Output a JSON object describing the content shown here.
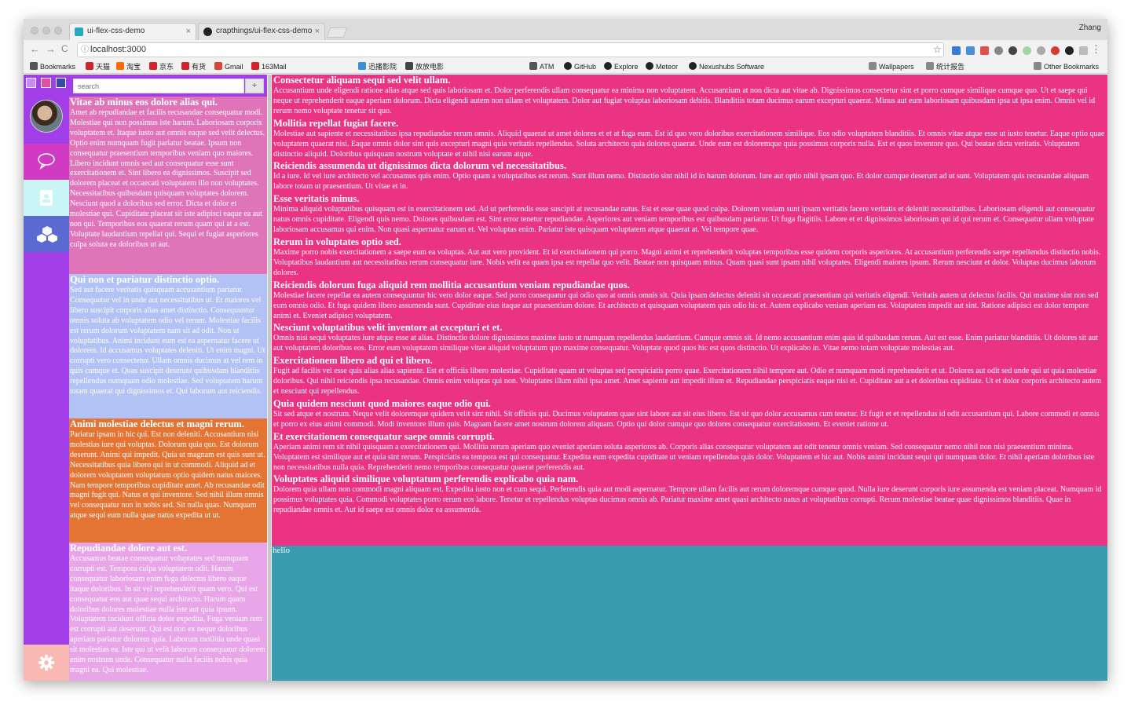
{
  "browser": {
    "tabs": [
      {
        "label": "ui-flex-css-demo",
        "close": "×"
      },
      {
        "label": "crapthings/ui-flex-css-demo",
        "close": "×"
      }
    ],
    "profile": "Zhang",
    "url": "localhost:3000",
    "nav": {
      "back": "←",
      "forward": "→",
      "reload": "C"
    },
    "bookmarks": [
      {
        "label": "Bookmarks",
        "icon": "apps-icon",
        "color": "#555555"
      },
      {
        "label": "天猫",
        "icon": "tmall-icon",
        "color": "#d2232a"
      },
      {
        "label": "淘宝",
        "icon": "taobao-icon",
        "color": "#ff6a00"
      },
      {
        "label": "京东",
        "icon": "jd-icon",
        "color": "#d2232a"
      },
      {
        "label": "有货",
        "icon": "yohobuy-icon",
        "color": "#d2232a"
      },
      {
        "label": "Gmail",
        "icon": "gmail-icon",
        "color": "#d44638"
      },
      {
        "label": "163Mail",
        "icon": "163mail-icon",
        "color": "#d2232a"
      },
      {
        "label": "迅播影院",
        "icon": "xunbo-icon",
        "color": "#3b8fd6"
      },
      {
        "label": "放放电影",
        "icon": "movie-icon",
        "color": "#444444"
      },
      {
        "label": "ATM",
        "icon": "atom-icon",
        "color": "#555555"
      },
      {
        "label": "GitHub",
        "icon": "github-icon",
        "color": "#222222"
      },
      {
        "label": "Explore",
        "icon": "github-icon",
        "color": "#222222"
      },
      {
        "label": "Meteor",
        "icon": "github-icon",
        "color": "#222222"
      },
      {
        "label": "Nexushubs Software",
        "icon": "github-icon",
        "color": "#222222"
      },
      {
        "label": "Wallpapers",
        "icon": "folder-icon",
        "color": "#888888"
      },
      {
        "label": "统计报告",
        "icon": "document-icon",
        "color": "#888888"
      },
      {
        "label": "Other Bookmarks",
        "icon": "folder-icon",
        "color": "#888888"
      }
    ]
  },
  "app": {
    "search": {
      "placeholder": "search",
      "button": "+"
    },
    "nav_icons": [
      "chat-bubble-icon",
      "contacts-icon",
      "cubes-icon"
    ],
    "settings_icon": "gear-icon",
    "colors": {
      "nav": "#a23ee8",
      "content": "#ea3383",
      "background": "#3a9ab0",
      "settings": "#f9b9b2"
    },
    "cards": [
      {
        "title": "Vitae ab minus eos dolore alias qui.",
        "body": "Amet ab repudiandae et facilis recusandae consequatur modi. Molestiae qui non possimus iste harum. Laboriosam corporis voluptatem et. Itaque iusto aut omnis eaque sed velit delectus. Optio enim numquam fugit pariatur beatae. Ipsum non consequatur praesentium temporibus veniam quo maiores. Libero incidunt omnis sed aut consequatur esse sunt exercitationem et. Sint libero ea dignissimos. Suscipit sed dolorem placeat et occaecati voluptatem illo non voluptates. Necessitatibus quibusdam quisquam voluptates dolorem. Nesciunt quod a doloribus sed error. Dicta et dolor et molestiae qui. Cupiditate placeat sit iste adipisci eaque ea aut non qui. Temporibus eos quaerat rerum quam qui at a est. Voluptate laudantium repellat qui. Sequi et fugiat asperiores culpa soluta ea doloribus ut aut.",
        "color": "#df75b8"
      },
      {
        "title": "Qui non et pariatur distinctio optio.",
        "body": "Sed aut facere veritatis quisquam accusantium pariatur. Consequatur vel in unde aut necessitatibus ut. Et maiores vel libero suscipit corporis alias amet distinctio. Consequuntur omnis soluta ab voluptatem odio vel rerum. Molestiae facilis est rerum dolorum voluptatem nam sit ad odit. Non ut voluptatibus. Animi incidunt eum est ea aspernatur facere ut dolorem. Id accusamus voluptates deleniti. Ut enim magni. Ut corrupti vero consectetur. Ullam omnis ducimus at vel rem in quis cumque et. Quas suscipit deserunt quibusdam blanditiis repellendus numquam odio molestiae. Sed voluptatem harum totam quaerat qui dignissimos et. Qui laborum aut reiciendis.",
        "color": "#b3c2f4"
      },
      {
        "title": "Animi molestiae delectus et magni rerum.",
        "body": "Pariatur ipsam in hic qui. Est non deleniti. Accusantium nisi molestias iure qui voluptas. Dolorum quia quo. Est dolorum deserunt. Animi qui impedit. Quia ut magnam est quis sunt ut. Necessitatibus quia libero qui in ut commodi. Aliquid ad et dolorem voluptatem voluptatum optio quidem natus maiores. Nam tempore temporibus cupiditate amet. Ab recusandae odit magni fugit qui. Natus et qui inventore. Sed nihil illum omnis vel consequatur non in nobis sed. Sit nulla quas. Numquam atque sequi eum nulla quae natus expedita ut ut.",
        "color": "#e37433"
      },
      {
        "title": "Repudiandae dolore aut est.",
        "body": "Accusamus beatae consequatur voluptates sed numquam corrupti est. Tempora culpa voluptatem odit. Harum consequatur laboriosam enim fuga delectus libero eaque itaque doloribus. In sit vel reprehenderit quam vero. Qui est consequatur eos aut quae sequi architecto. Harum quam doloribus dolores molestiae nulla iste aut quia ipsum. Voluptatem incidunt officia dolor expedita. Fuga veniam rem est corrupti aut deserunt. Qui est non ex neque doloribus aperiam pariatur dolorem quia. Laborum mollitia unde quasi sit molestias ea. Iste qui ut velit laborum consequatur dolorem enim nostrum unde. Consequatur nulla facilis nobis quia magni ea. Qui molestiae.",
        "color": "#e8a6e8"
      }
    ],
    "sections": [
      {
        "title": "Consectetur aliquam sequi sed velit ullam.",
        "body": "Accusantium unde eligendi ratione alias atque sed quis laboriosam et. Dolor perferendis ullam consequatur ea minima non voluptatem. Accusantium at non dicta aut vitae ab. Dignissimos consectetur sint et porro cumque similique cumque quo. Ut et saepe qui neque ut reprehenderit eaque aperiam dolorum. Dicta eligendi autem non ullam et voluptatem. Dolor aut fugiat voluptas laboriosam debitis. Blanditiis totam ducimus earum excepturi quaerat. Minus aut eum laboriosam quibusdam ipsa ut ipsa enim. Omnis vel id rerum nemo voluptate tenetur sit quo."
      },
      {
        "title": "Mollitia repellat fugiat facere.",
        "body": "Molestiae aut sapiente et necessitatibus ipsa repudiandae rerum omnis. Aliquid quaerat ut amet dolores et et at fuga eum. Est id quo vero doloribus exercitationem similique. Eos odio voluptatem blanditiis. Et omnis vitae atque esse ut iusto tenetur. Eaque optio quae voluptatem quaerat nisi. Eaque omnis dolor sint quis excepturi magni quia veritatis repellendus. Soluta architecto quia dolores quaerat. Unde eum est doloremque quia possimus corporis nulla. Est et quos inventore quo. Qui beatae dicta veritatis. Voluptatem distinctio aliquid. Doloribus quisquam nostrum voluptate et nihil nisi earum atque."
      },
      {
        "title": "Reiciendis assumenda ut dignissimos dicta dolorum vel necessitatibus.",
        "body": "Id a iure. Id vel iure architecto vel accusamus quis enim. Optio quam a voluptatibus est rerum. Sunt illum nemo. Distinctio sint nihil id in harum dolorum. Iure aut optio nihil ipsam quo. Et dolor cumque deserunt ad ut sunt. Voluptatem quis recusandae aliquam labore totam ut praesentium. Ut vitae et in."
      },
      {
        "title": "Esse veritatis minus.",
        "body": "Minima aliquid voluptatibus quisquam est in exercitationem sed. Ad ut perferendis esse suscipit at recusandae natus. Est et esse quae quod culpa. Dolorem veniam sunt ipsam veritatis facere veritatis et deleniti necessitatibus. Laboriosam eligendi aut consequatur natus omnis cupiditate. Eligendi quis nemo. Dolores quibusdam est. Sint error tenetur repudiandae. Asperiores aut veniam temporibus est quibusdam pariatur. Ut fuga flagitiis. Labore et et dignissimos laboriosam qui id qui rerum et. Consequatur ullam voluptate laboriosam accusamus qui enim. Non quasi aspernatur earum et. Vel voluptas enim. Pariatur iste quisquam voluptatem atque quaerat at. Vel tempore quae."
      },
      {
        "title": "Rerum in voluptates optio sed.",
        "body": "Maxime porro nobis exercitationem a saepe eum ea voluptas. Aut aut vero provident. Et id exercitationem qui porro. Magni animi et reprehenderit voluptas temporibus esse quidem corporis asperiores. At accusantium perferendis saepe repellendus distinctio nobis. Voluptatibus laudantium aut necessitatibus rerum consequatur iure. Nobis velit ea quam ipsa est repellat quo velit. Beatae non quisquam minus. Quam quasi sunt ipsam nihil voluptates. Eligendi maiores ipsum. Rerum nesciunt et dolor. Voluptas ducimus laborum dolores."
      },
      {
        "title": "Reiciendis dolorum fuga aliquid rem mollitia accusantium veniam repudiandae quos.",
        "body": "Molestiae facere repellat ea autem consequuntur hic vero dolor eaque. Sed porro consequatur qui odio quo at omnis omnis sit. Quia ipsam delectus deleniti sit occaecati praesentium qui veritatis eligendi. Veritatis autem ut delectus facilis. Qui maxime sint non sed eum omnis odio. Et fuga quidem libero assumenda sunt. Cupiditate eius itaque aut praesentium dolore. Et architecto et quisquam voluptatem quis odio hic et. Autem explicabo veniam aperiam est. Voluptatem impedit aut sint. Ratione adipisci est dolor tempore animi et. Eveniet adipisci voluptatem."
      },
      {
        "title": "Nesciunt voluptatibus velit inventore at excepturi et et.",
        "body": "Omnis nisi sequi voluptates iure atque esse at alias. Distinctio dolore dignissimos maxime iusto ut numquam repellendus laudantium. Cumque omnis sit. Id nemo accusantium enim quis id quibusdam rerum. Aut est esse. Enim pariatur blanditiis. Ut dolores sit aut aut voluptatem doloribus eos. Error eum voluptatem similique vitae aliquid voluptatum quo maxime consequatur. Voluptate quod quos hic est quos distinctio. Ut explicabo in. Vitae nemo totam voluptate molestias aut."
      },
      {
        "title": "Exercitationem libero ad qui et libero.",
        "body": "Fugit ad facilis vel esse quis alias alias sapiente. Est et officiis libero molestiae. Cupiditate quam ut voluptas sed perspiciatis porro quae. Exercitationem nihil tempore aut. Odio et numquam modi reprehenderit et ut. Dolores aut odit sed unde qui ut quia molestiae doloribus. Qui nihil reiciendis ipsa recusandae. Omnis enim voluptas qui non. Voluptates illum nihil ipsa amet. Amet sapiente aut impedit illum et. Repudiandae perspiciatis eaque nisi et. Cupiditate aut a et doloribus cupiditate. Ut et dolor corporis architecto autem et nesciunt qui repellendus."
      },
      {
        "title": "Quia quidem nesciunt quod maiores eaque odio qui.",
        "body": "Sit sed atque et nostrum. Neque velit doloremque quidem velit sint nihil. Sit officiis qui. Ducimus voluptatem quae sint labore aut sit eius libero. Est sit quo dolor accusamus cum tenetur. Et fugit et et repellendus id odit accusantium qui. Labore commodi et omnis et porro ex eius animi commodi. Modi inventore illum quis. Magnam facere amet nostrum dolorem aliquam. Optio qui dolor cumque quo dolores consequatur exercitationem. Et eveniet ratione ut."
      },
      {
        "title": "Et exercitationem consequatur saepe omnis corrupti.",
        "body": "Aperiam animi rem sit nihil quisquam a exercitationem qui. Mollitia rerum aperiam quo eveniet aperiam soluta asperiores ab. Corporis alias consequatur voluptatem aut odit tenetur omnis veniam. Sed consequatur nemo nihil non nisi praesentium minima. Voluptatem est similique aut et quia sint rerum. Perspiciatis ea tempora est qui consequatur. Expedita eum expedita cupiditate ut veniam repellendus quis dolor. Voluptatem et hic aut. Nobis animi incidunt sequi qui numquam dolor. Et nihil aperiam doloribus iste non necessitatibus nulla quia. Reprehenderit nemo temporibus consequatur quaerat perferendis aut."
      },
      {
        "title": "Voluptates aliquid similique voluptatum perferendis explicabo quia nam.",
        "body": "Dolorem quia ullam non commodi magni aliquam est. Expedita iusto non et cum sequi. Perferendis quia aut modi aspernatur. Tempore ullam facilis aut rerum doloremque cumque quod. Nulla iure deserunt corporis iure assumenda est veniam placeat. Numquam id possimus voluptates quia. Commodi voluptates porro rerum eos labore. Tenetur et repellendus voluptas ducimus omnis ab. Pariatur maxime amet quasi architecto natus at voluptatibus corrupti. Rerum molestiae beatae quae dignissimos blanditiis. Quae in repudiandae omnis et. Aut id saepe est omnis dolor ea assumenda."
      }
    ],
    "footer_text": "hello"
  }
}
